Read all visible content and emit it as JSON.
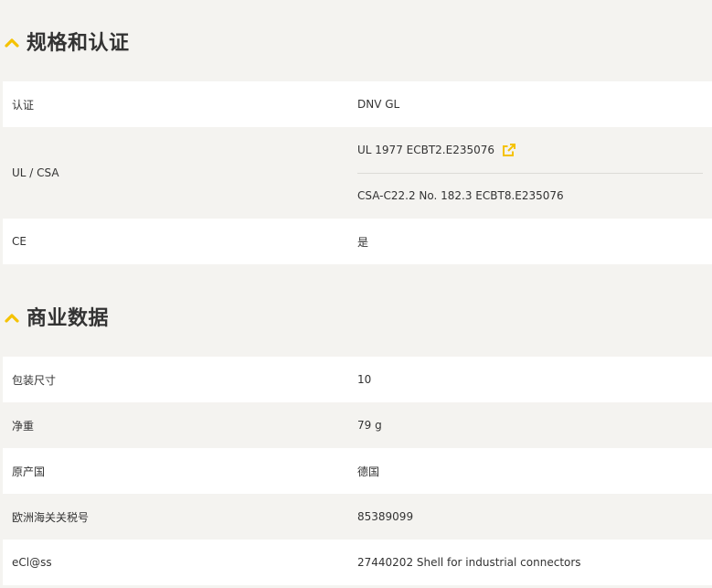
{
  "colors": {
    "accent": "#f5c200",
    "page_background": "#f4f3f0",
    "row_white": "#ffffff",
    "text": "#333333"
  },
  "certifications": {
    "title": "规格和认证",
    "toggle_icon": "chevron-up-icon",
    "rows": [
      {
        "label": "认证",
        "values": [
          "DNV GL"
        ]
      },
      {
        "label": "UL / CSA",
        "values": [
          "UL 1977 ECBT2.E235076",
          "CSA-C22.2 No. 182.3 ECBT8.E235076"
        ],
        "link_icon": "external-link-icon"
      },
      {
        "label": "CE",
        "values": [
          "是"
        ]
      }
    ]
  },
  "commercial": {
    "title": "商业数据",
    "toggle_icon": "chevron-up-icon",
    "rows": [
      {
        "label": "包装尺寸",
        "value": "10"
      },
      {
        "label": "净重",
        "value": "79 g"
      },
      {
        "label": "原产国",
        "value": "德国"
      },
      {
        "label": "欧洲海关关税号",
        "value": "85389099"
      },
      {
        "label": "eCl@ss",
        "value": "27440202 Shell for industrial connectors"
      }
    ]
  }
}
